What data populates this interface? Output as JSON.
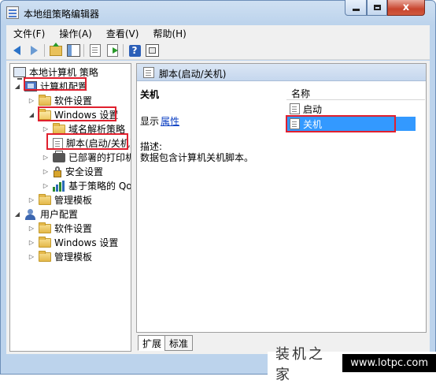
{
  "window": {
    "title": "本地组策略编辑器",
    "close_glyph": "x"
  },
  "menu": [
    "文件(F)",
    "操作(A)",
    "查看(V)",
    "帮助(H)"
  ],
  "toolbar": {
    "help_glyph": "?"
  },
  "tree": {
    "nodes": [
      {
        "label": "本地计算机 策略"
      },
      {
        "label": "计算机配置"
      },
      {
        "label": "软件设置"
      },
      {
        "label": "Windows 设置"
      },
      {
        "label": "域名解析策略"
      },
      {
        "label": "脚本(启动/关机)"
      },
      {
        "label": "已部署的打印机"
      },
      {
        "label": "安全设置"
      },
      {
        "label": "基于策略的 QoS"
      },
      {
        "label": "管理模板"
      },
      {
        "label": "用户配置"
      },
      {
        "label": "软件设置"
      },
      {
        "label": "Windows 设置"
      },
      {
        "label": "管理模板"
      }
    ]
  },
  "details": {
    "header": "脚本(启动/关机)",
    "title": "关机",
    "show_label": "显示",
    "properties_link": "属性",
    "desc_label": "描述:",
    "desc_text": "数据包含计算机关机脚本。",
    "column_name": "名称",
    "items": [
      {
        "label": "启动"
      },
      {
        "label": "关机"
      }
    ]
  },
  "tabs": [
    "扩展",
    "标准"
  ],
  "watermark": {
    "text": "装机之家",
    "url": "www.lotpc.com"
  },
  "colors": {
    "highlight_red": "#e0202e",
    "selection_blue": "#3399ff",
    "link_blue": "#0a3ec2"
  }
}
